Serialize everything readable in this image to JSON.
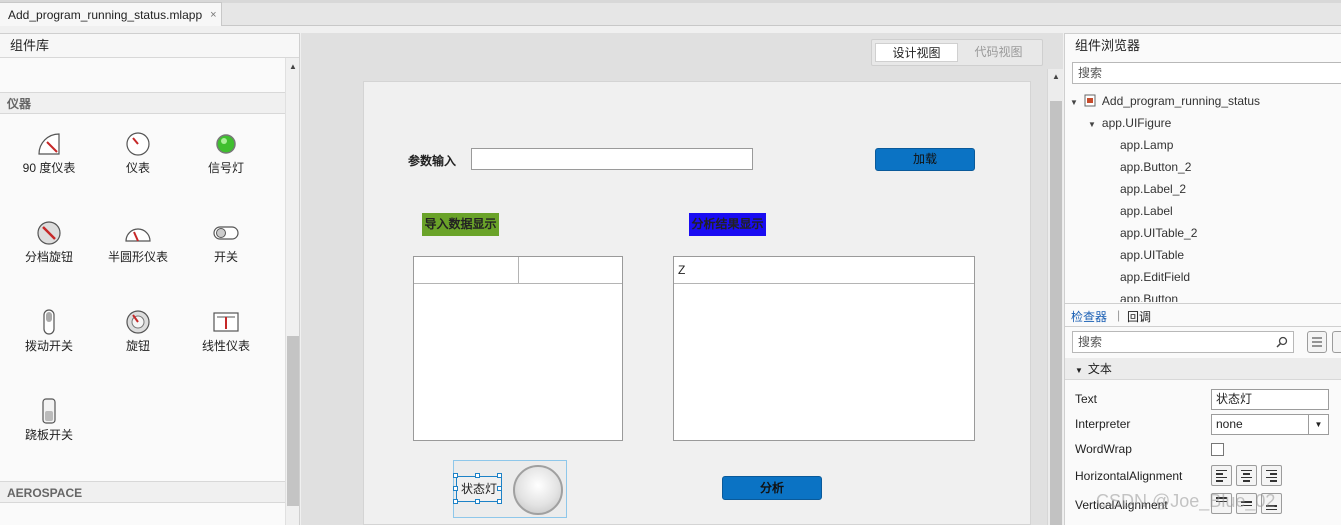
{
  "tab": {
    "title": "Add_program_running_status.mlapp",
    "close": "×"
  },
  "library": {
    "title": "组件库",
    "section_instruments": "仪器",
    "components": [
      {
        "label": "90 度仪表",
        "icon": "gauge-90-icon"
      },
      {
        "label": "仪表",
        "icon": "gauge-icon"
      },
      {
        "label": "信号灯",
        "icon": "lamp-icon"
      },
      {
        "label": "分档旋钮",
        "icon": "discrete-knob-icon"
      },
      {
        "label": "半圆形仪表",
        "icon": "semicircular-gauge-icon"
      },
      {
        "label": "开关",
        "icon": "switch-icon"
      },
      {
        "label": "拨动开关",
        "icon": "toggle-switch-icon"
      },
      {
        "label": "旋钮",
        "icon": "knob-icon"
      },
      {
        "label": "线性仪表",
        "icon": "linear-gauge-icon"
      },
      {
        "label": "跷板开关",
        "icon": "rocker-switch-icon"
      }
    ],
    "section_aerospace": "AEROSPACE"
  },
  "view_toggle": {
    "design": "设计视图",
    "code": "代码视图"
  },
  "figure": {
    "param_label": "参数输入",
    "edit_value": "",
    "load_button": "加载",
    "import_tag": "导入数据显示",
    "analysis_tag": "分析结果显示",
    "table1_columns": [
      "",
      ""
    ],
    "table2_columns": [
      "Z"
    ],
    "lamp_label": "状态灯",
    "analyze_button": "分析"
  },
  "browser": {
    "title": "组件浏览器",
    "search_placeholder": "搜索",
    "root": "Add_program_running_status",
    "figure_node": "app.UIFigure",
    "children": [
      "app.Lamp",
      "app.Button_2",
      "app.Label_2",
      "app.Label",
      "app.UITable_2",
      "app.UITable",
      "app.EditField",
      "app.Button"
    ]
  },
  "inspector": {
    "tab_inspector": "检查器",
    "tab_callback": "回调",
    "search_placeholder": "搜索",
    "group_text": "文本",
    "props": {
      "text_label": "Text",
      "text_value": "状态灯",
      "interpreter_label": "Interpreter",
      "interpreter_value": "none",
      "wordwrap_label": "WordWrap",
      "halign_label": "HorizontalAlignment",
      "valign_label": "VerticalAlignment"
    }
  },
  "watermark": "CSDN @Joe_Blue_02",
  "colors": {
    "accent_button": "#0b73c4",
    "import_tag": "#6aa329",
    "analysis_tag": "#1a0cf2"
  }
}
